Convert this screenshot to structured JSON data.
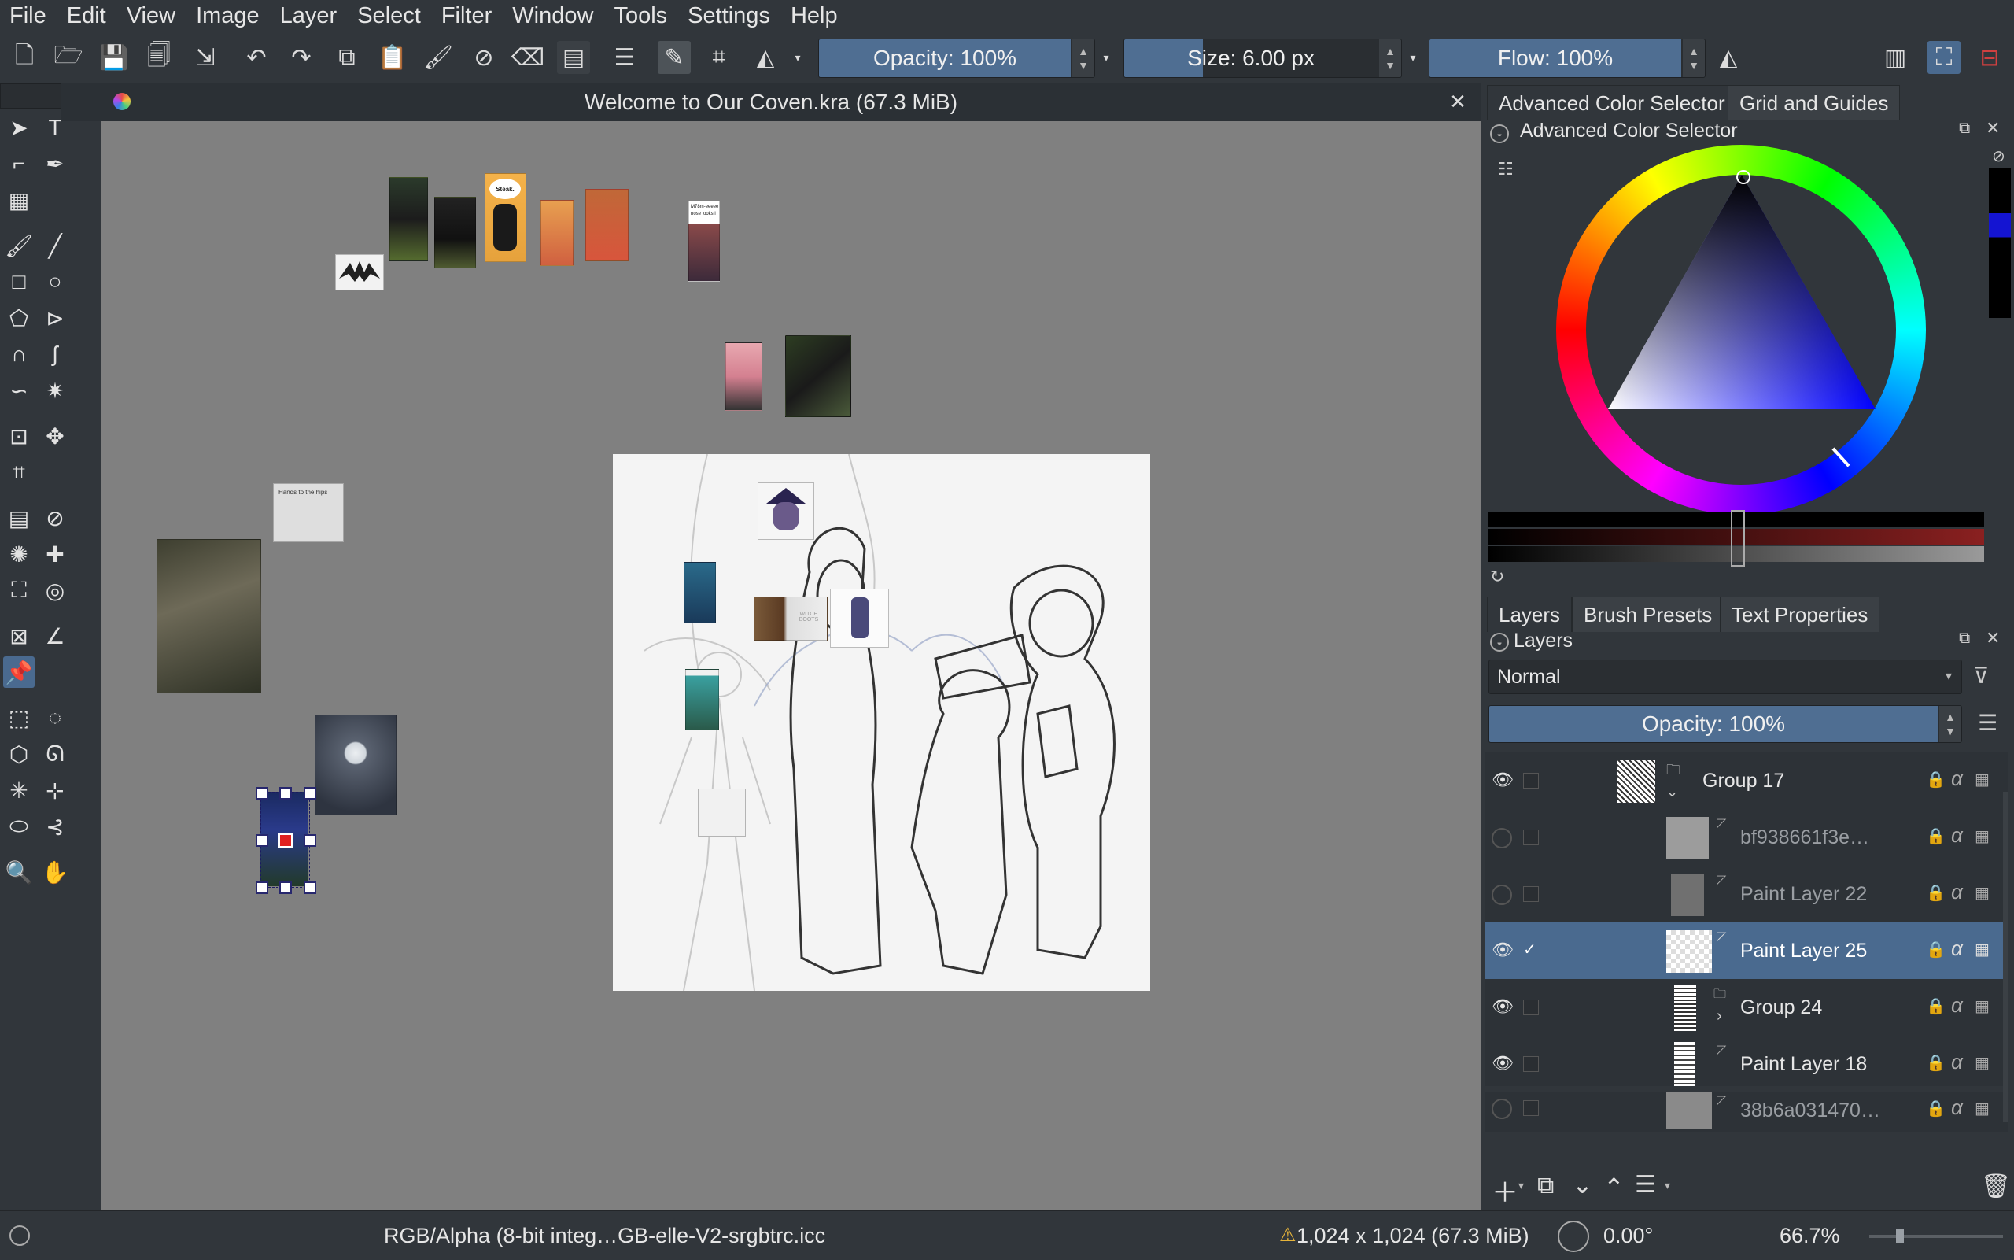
{
  "menu": [
    "File",
    "Edit",
    "View",
    "Image",
    "Layer",
    "Select",
    "Filter",
    "Window",
    "Tools",
    "Settings",
    "Help"
  ],
  "toolbar": {
    "opacity": {
      "label": "Opacity: 100%",
      "fraction": 1.0
    },
    "size": {
      "label": "Size: 6.00 px",
      "fraction": 0.25
    },
    "flow": {
      "label": "Flow: 100%",
      "fraction": 1.0
    }
  },
  "document": {
    "title": "Welcome to Our Coven.kra (67.3 MiB)"
  },
  "canvas": {
    "speech_text": "Steak.",
    "note_text_1": "M78m-eeeee",
    "note_text_2": "nose looks l",
    "sketch_caption": "Hands to the hips",
    "card_text": "WITCH BOOTS"
  },
  "dock_tabs_top": [
    {
      "label": "Advanced Color Selector",
      "selected": true
    },
    {
      "label": "Grid and Guides",
      "selected": false
    }
  ],
  "color_selector": {
    "title": "Advanced Color Selector",
    "selected_color": "#1414d2"
  },
  "dock_tabs_bottom": [
    {
      "label": "Layers",
      "selected": true
    },
    {
      "label": "Brush Presets",
      "selected": false
    },
    {
      "label": "Text Properties",
      "selected": false
    }
  ],
  "layers_panel": {
    "title": "Layers",
    "blend_mode": "Normal",
    "opacity_label": "Opacity: 100%",
    "layers": [
      {
        "name": "Group 17",
        "visible": true,
        "selected": false,
        "type": "group",
        "expanded": true
      },
      {
        "name": "bf938661f3e…",
        "visible": false,
        "selected": false,
        "type": "paint"
      },
      {
        "name": "Paint Layer 22",
        "visible": false,
        "selected": false,
        "type": "paint"
      },
      {
        "name": "Paint Layer 25",
        "visible": true,
        "selected": true,
        "type": "paint"
      },
      {
        "name": "Group 24",
        "visible": true,
        "selected": false,
        "type": "group",
        "expanded": false
      },
      {
        "name": "Paint Layer 18",
        "visible": true,
        "selected": false,
        "type": "paint"
      },
      {
        "name": "38b6a031470…",
        "visible": false,
        "selected": false,
        "type": "paint"
      }
    ]
  },
  "status": {
    "color_profile": "RGB/Alpha (8-bit integ…GB-elle-V2-srgbtrc.icc",
    "dimensions": "1,024 x 1,024 (67.3 MiB)",
    "rotation": "0.00°",
    "zoom": "66.7%"
  }
}
